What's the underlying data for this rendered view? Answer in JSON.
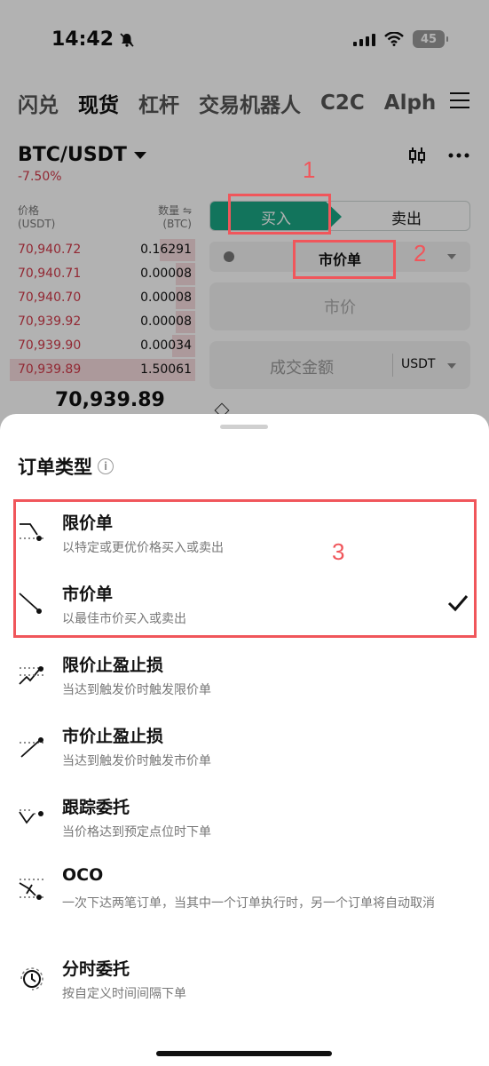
{
  "status_bar": {
    "time": "14:42",
    "battery": "45"
  },
  "top_tabs": [
    {
      "label": "闪兑",
      "active": false
    },
    {
      "label": "现货",
      "active": true
    },
    {
      "label": "杠杆",
      "active": false
    },
    {
      "label": "交易机器人",
      "active": false
    },
    {
      "label": "C2C",
      "active": false
    },
    {
      "label": "Alph",
      "active": false
    }
  ],
  "pair": {
    "symbol": "BTC/USDT",
    "change": "-7.50%"
  },
  "order_book": {
    "price_header": "价格",
    "price_unit": "(USDT)",
    "qty_header": "数量 ⇋",
    "qty_unit": "(BTC)",
    "asks": [
      {
        "price": "70,940.72",
        "qty": "0.16291",
        "depth": 0.18
      },
      {
        "price": "70,940.71",
        "qty": "0.00008",
        "depth": 0.1
      },
      {
        "price": "70,940.70",
        "qty": "0.00008",
        "depth": 0.1
      },
      {
        "price": "70,939.92",
        "qty": "0.00008",
        "depth": 0.1
      },
      {
        "price": "70,939.90",
        "qty": "0.00034",
        "depth": 0.12
      },
      {
        "price": "70,939.89",
        "qty": "1.50061",
        "depth": 0.95
      }
    ],
    "last_price": "70,939.89"
  },
  "trade_panel": {
    "buy_label": "买入",
    "sell_label": "卖出",
    "order_type": "市价单",
    "price_placeholder": "市价",
    "amount_placeholder": "成交金额",
    "amount_unit": "USDT"
  },
  "annotations": {
    "n1": "1",
    "n2": "2",
    "n3": "3",
    "color": "#f0565b"
  },
  "sheet": {
    "title": "订单类型",
    "options": [
      {
        "name": "限价单",
        "desc": "以特定或更优价格买入或卖出",
        "icon": "limit-order-icon",
        "selected": false
      },
      {
        "name": "市价单",
        "desc": "以最佳市价买入或卖出",
        "icon": "market-order-icon",
        "selected": true
      },
      {
        "name": "限价止盈止损",
        "desc": "当达到触发价时触发限价单",
        "icon": "limit-tp-sl-icon",
        "selected": false
      },
      {
        "name": "市价止盈止损",
        "desc": "当达到触发价时触发市价单",
        "icon": "market-tp-sl-icon",
        "selected": false
      },
      {
        "name": "跟踪委托",
        "desc": "当价格达到预定点位时下单",
        "icon": "trailing-order-icon",
        "selected": false
      },
      {
        "name": "OCO",
        "desc": "一次下达两笔订单，当其中一个订单执行时，另一个订单将自动取消",
        "icon": "oco-icon",
        "selected": false
      },
      {
        "name": "分时委托",
        "desc": "按自定义时间间隔下单",
        "icon": "time-order-icon",
        "selected": false
      }
    ]
  },
  "colors": {
    "buy": "#1aa784",
    "sell_price": "#d23a4a",
    "accent_red": "#f0565b"
  }
}
